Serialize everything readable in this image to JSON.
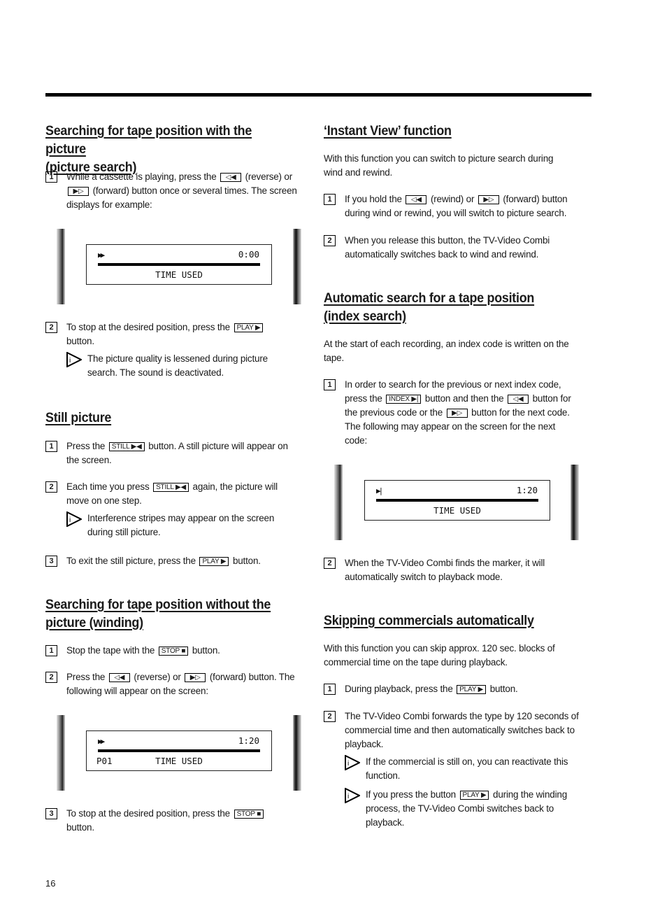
{
  "page_number": "16",
  "left": {
    "picture_search": {
      "title_l1": "Searching for tape position with the picture",
      "title_l2": "(picture search)",
      "steps": [
        {
          "num": "1",
          "t1": "While a cassette is playing, press the",
          "key1": "◁◀",
          "t2": "(reverse) or",
          "key2": "▶▷",
          "t3": "(forward) button once or several times. The screen",
          "t4": "displays for example:"
        },
        {
          "num": "2",
          "t1": "To stop at the desired position, press the",
          "key1": "PLAY ▶",
          "t2": "button.",
          "note": "The picture quality is lessened during picture",
          "note2": "search. The sound is deactivated."
        }
      ],
      "screen": {
        "symbol": "▶▶",
        "time": "0:00",
        "label": "TIME USED",
        "program": ""
      }
    },
    "still_picture": {
      "title": "Still picture",
      "steps": [
        {
          "num": "1",
          "t1": "Press the",
          "key1": "STILL ▶◀",
          "t2": "button. A still picture will appear on",
          "t3": "the screen."
        },
        {
          "num": "2",
          "t1": "Each time you press",
          "key1": "STILL ▶◀",
          "t2": "again, the picture will",
          "t3": "move on one step.",
          "note": "Interference stripes may appear on the screen",
          "note2": "during still picture."
        },
        {
          "num": "3",
          "t1": "To exit the still picture, press the",
          "key1": "PLAY ▶",
          "t2": "button."
        }
      ]
    },
    "winding": {
      "title_l1": "Searching for tape position without the",
      "title_l2": "picture (winding)",
      "steps": [
        {
          "num": "1",
          "t1": "Stop the tape with the",
          "key1": "STOP ■",
          "t2": "button."
        },
        {
          "num": "2",
          "t1": "Press the",
          "key1": "◁◀",
          "t2": "(reverse) or",
          "key2": "▶▷",
          "t3": "(forward) button. The",
          "t4": "following will appear on the screen:"
        },
        {
          "num": "3",
          "t1": "To stop at the desired position, press the",
          "key1": "STOP ■",
          "t2": "button."
        }
      ],
      "screen": {
        "symbol": "▶▶",
        "time": "1:20",
        "label": "TIME USED",
        "program": "P01"
      }
    }
  },
  "right": {
    "instant_view": {
      "title": "‘Instant View’ function",
      "intro_l1": "With this function you can switch to picture search during",
      "intro_l2": "wind and rewind.",
      "steps": [
        {
          "num": "1",
          "t1": "If you hold the",
          "key1": "◁◀",
          "t2": "(rewind) or",
          "key2": "▶▷",
          "t3": "(forward) button",
          "t4": "during wind or rewind, you will switch to picture search."
        },
        {
          "num": "2",
          "t1": "When you release this button, the TV-Video Combi",
          "t2": "automatically switches back to wind and rewind."
        }
      ]
    },
    "index_search": {
      "title_l1": "Automatic search for a tape position",
      "title_l2": "(index search)",
      "intro_l1": "At the start of each recording, an index code is written on the",
      "intro_l2": "tape.",
      "steps": [
        {
          "num": "1",
          "t1": "In order to search for the previous or next index code,",
          "t2": "press the",
          "key1": "INDEX ▶|",
          "t3": "button and then the",
          "key2": "◁◀",
          "t4": "button for",
          "t5": "the previous code or the",
          "key3": "▶▷",
          "t6": "button for the next code.",
          "t7": "The following may appear on the screen for the next",
          "t8": "code:"
        },
        {
          "num": "2",
          "t1": "When the TV-Video Combi finds the marker, it will",
          "t2": "automatically switch to playback mode."
        }
      ],
      "screen": {
        "symbol": "▶|",
        "time": "1:20",
        "label": "TIME USED",
        "program": ""
      }
    },
    "commercials": {
      "title": "Skipping commercials automatically",
      "intro_l1": "With this function you can skip approx. 120 sec. blocks of",
      "intro_l2": "commercial time on the tape during playback.",
      "steps": [
        {
          "num": "1",
          "t1": "During playback, press the",
          "key1": "PLAY ▶",
          "t2": "button."
        },
        {
          "num": "2",
          "t1": "The TV-Video Combi forwards the type by 120 seconds of",
          "t2": "commercial time and then automatically switches back to",
          "t3": "playback.",
          "note_a1": "If the commercial is still on, you can reactivate this",
          "note_a2": "function.",
          "note_b1": "If you press the button",
          "note_b_key": "PLAY ▶",
          "note_b2": "during the winding",
          "note_b3": "process, the TV-Video Combi switches back to",
          "note_b4": "playback."
        }
      ]
    }
  }
}
